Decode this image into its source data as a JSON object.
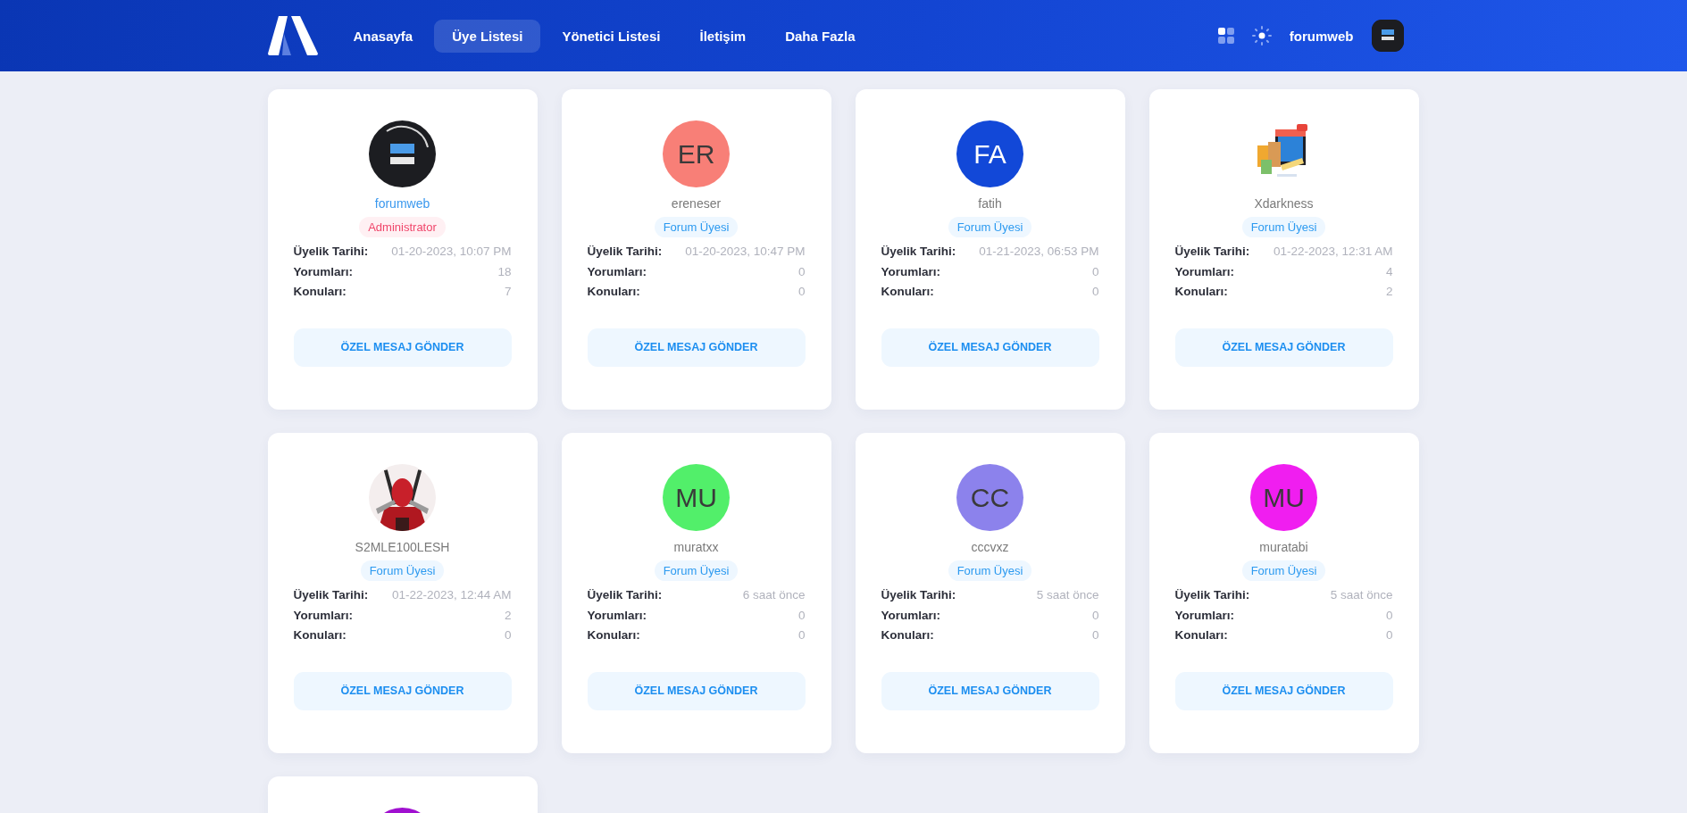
{
  "header": {
    "nav": [
      {
        "label": "Anasayfa",
        "selected": false
      },
      {
        "label": "Üye Listesi",
        "selected": true
      },
      {
        "label": "Yönetici Listesi",
        "selected": false
      },
      {
        "label": "İletişim",
        "selected": false
      },
      {
        "label": "Daha Fazla",
        "selected": false
      }
    ],
    "user": {
      "name": "forumweb"
    }
  },
  "members": [
    {
      "avatar": {
        "kind": "logo"
      },
      "username": "forumweb",
      "role": {
        "kind": "admin",
        "label": "Administrator"
      },
      "stats": [
        {
          "label": "Üyelik Tarihi:",
          "value": "01-20-2023, 10:07 PM"
        },
        {
          "label": "Yorumları:",
          "value": "18"
        },
        {
          "label": "Konuları:",
          "value": "7"
        }
      ],
      "button": "ÖZEL MESAJ GÖNDER"
    },
    {
      "avatar": {
        "kind": "initials",
        "initials": "ER",
        "color": "#f87f77"
      },
      "username": "ereneser",
      "role": {
        "kind": "member",
        "label": "Forum Üyesi"
      },
      "stats": [
        {
          "label": "Üyelik Tarihi:",
          "value": "01-20-2023, 10:47 PM"
        },
        {
          "label": "Yorumları:",
          "value": "0"
        },
        {
          "label": "Konuları:",
          "value": "0"
        }
      ],
      "button": "ÖZEL MESAJ GÖNDER"
    },
    {
      "avatar": {
        "kind": "initials",
        "initials": "FA",
        "color": "#1248d8"
      },
      "username": "fatih",
      "role": {
        "kind": "member",
        "label": "Forum Üyesi"
      },
      "stats": [
        {
          "label": "Üyelik Tarihi:",
          "value": "01-21-2023, 06:53 PM"
        },
        {
          "label": "Yorumları:",
          "value": "0"
        },
        {
          "label": "Konuları:",
          "value": "0"
        }
      ],
      "button": "ÖZEL MESAJ GÖNDER"
    },
    {
      "username": "Xdarkness",
      "role": {
        "kind": "member",
        "label": "Forum Üyesi"
      },
      "stats": [
        {
          "label": "Üyelik Tarihi:",
          "value": "01-22-2023, 12:31 AM"
        },
        {
          "label": "Yorumları:",
          "value": "4"
        },
        {
          "label": "Konuları:",
          "value": "2"
        }
      ],
      "button": "ÖZEL MESAJ GÖNDER"
    },
    {
      "avatar": {
        "kind": "figure"
      },
      "username": "S2MLE100LESH",
      "role": {
        "kind": "member",
        "label": "Forum Üyesi"
      },
      "stats": [
        {
          "label": "Üyelik Tarihi:",
          "value": "01-22-2023, 12:44 AM"
        },
        {
          "label": "Yorumları:",
          "value": "2"
        },
        {
          "label": "Konuları:",
          "value": "0"
        }
      ],
      "button": "ÖZEL MESAJ GÖNDER"
    },
    {
      "avatar": {
        "kind": "initials",
        "initials": "MU",
        "color": "#52ef6a"
      },
      "username": "muratxx",
      "role": {
        "kind": "member",
        "label": "Forum Üyesi"
      },
      "stats": [
        {
          "label": "Üyelik Tarihi:",
          "value": "6 saat önce"
        },
        {
          "label": "Yorumları:",
          "value": "0"
        },
        {
          "label": "Konuları:",
          "value": "0"
        }
      ],
      "button": "ÖZEL MESAJ GÖNDER"
    },
    {
      "avatar": {
        "kind": "initials",
        "initials": "CC",
        "color": "#8c82ec"
      },
      "username": "cccvxz",
      "role": {
        "kind": "member",
        "label": "Forum Üyesi"
      },
      "stats": [
        {
          "label": "Üyelik Tarihi:",
          "value": "5 saat önce"
        },
        {
          "label": "Yorumları:",
          "value": "0"
        },
        {
          "label": "Konuları:",
          "value": "0"
        }
      ],
      "button": "ÖZEL MESAJ GÖNDER"
    },
    {
      "avatar": {
        "kind": "initials",
        "initials": "MU",
        "color": "#f01ef0"
      },
      "username": "muratabi",
      "role": {
        "kind": "member",
        "label": "Forum Üyesi"
      },
      "stats": [
        {
          "label": "Üyelik Tarihi:",
          "value": "5 saat önce"
        },
        {
          "label": "Yorumları:",
          "value": "0"
        },
        {
          "label": "Konuları:",
          "value": "0"
        }
      ],
      "button": "ÖZEL MESAJ GÖNDER"
    },
    {
      "avatar": {
        "kind": "initials",
        "color": "#a010d0"
      }
    }
  ]
}
